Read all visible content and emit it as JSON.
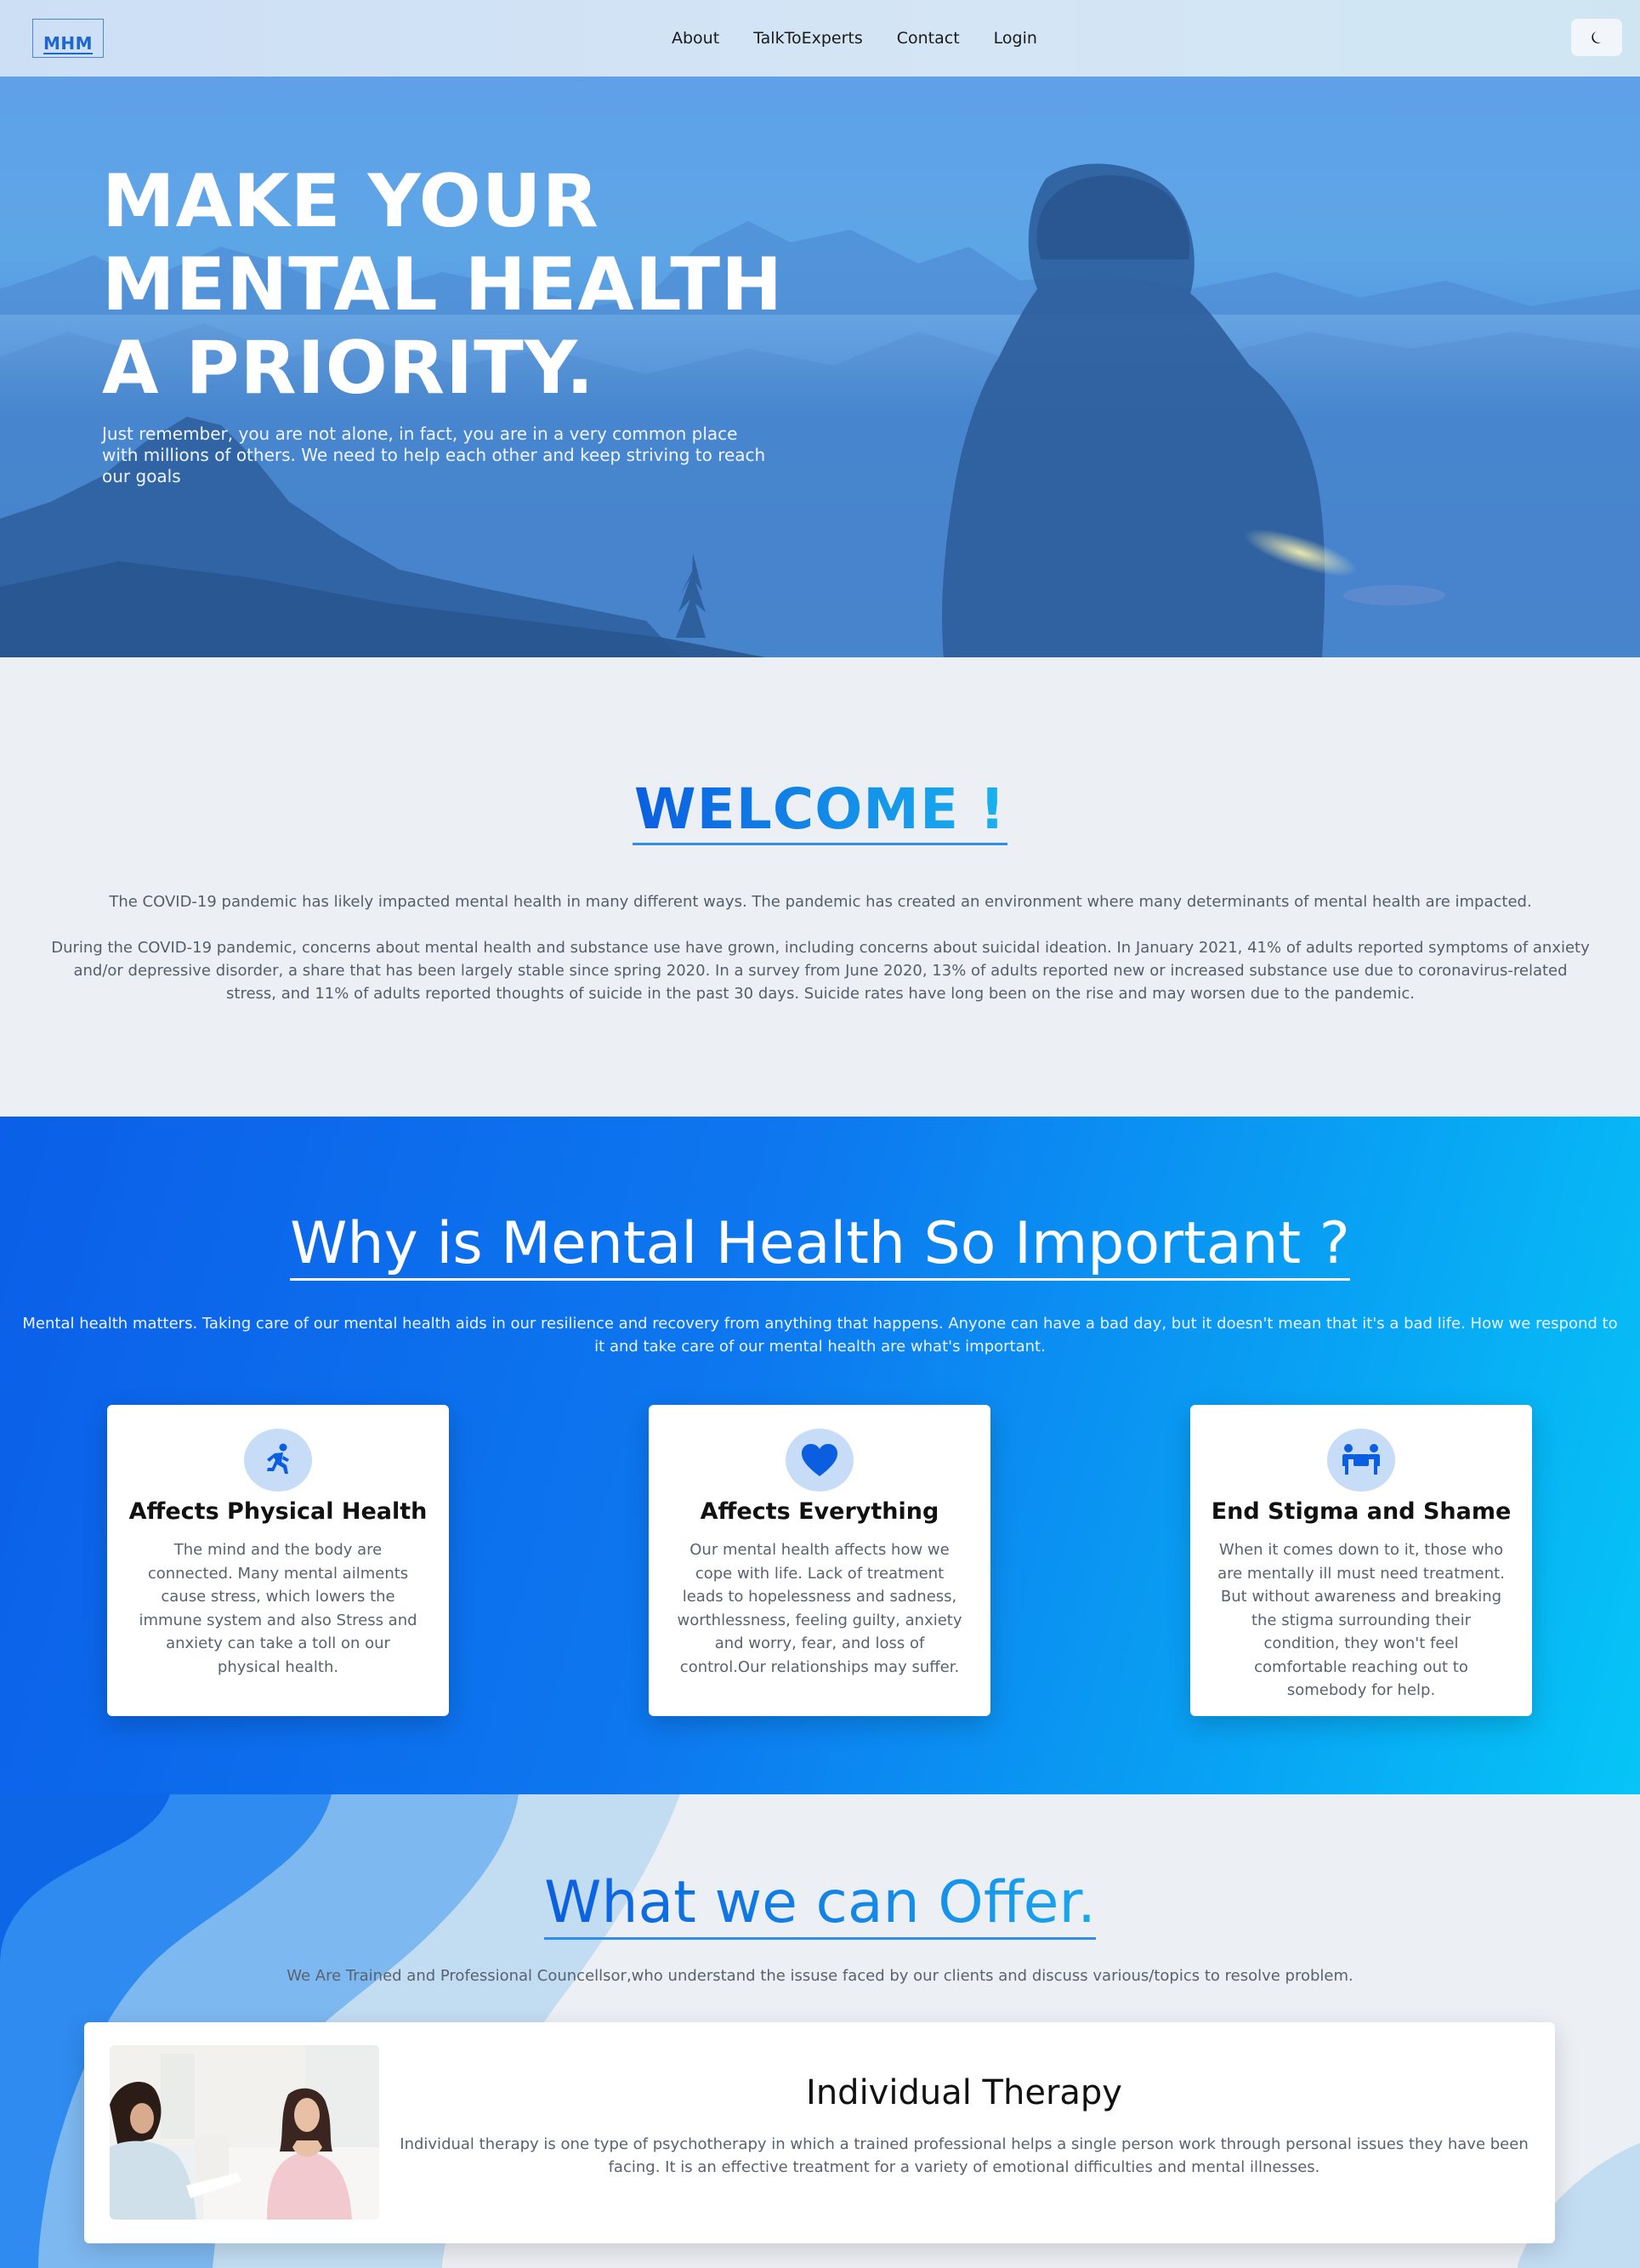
{
  "nav": {
    "logo_text": "MHM",
    "links": [
      "About",
      "TalkToExperts",
      "Contact",
      "Login"
    ],
    "theme_icon": "moon-icon"
  },
  "hero": {
    "title_lines": [
      "MAKE YOUR",
      "MENTAL HEALTH",
      "A PRIORITY."
    ],
    "subtitle": "Just remember, you are not alone, in fact, you are in a very common place with millions of others. We need to help each other and keep striving to reach our goals"
  },
  "welcome": {
    "heading": "WELCOME !",
    "paragraph1": "The COVID-19 pandemic has likely impacted mental health in many different ways. The pandemic has created an environment where many determinants of mental health are impacted.",
    "paragraph2": "During the COVID-19 pandemic, concerns about mental health and substance use have grown, including concerns about suicidal ideation. In January 2021, 41% of adults reported symptoms of anxiety and/or depressive disorder, a share that has been largely stable since spring 2020. In a survey from June 2020, 13% of adults reported new or increased substance use due to coronavirus-related stress, and 11% of adults reported thoughts of suicide in the past 30 days. Suicide rates have long been on the rise and may worsen due to the pandemic."
  },
  "why": {
    "heading": "Why is Mental Health So Important ?",
    "lead": "Mental health matters. Taking care of our mental health aids in our resilience and recovery from anything that happens. Anyone can have a bad day, but it doesn't mean that it's a bad life. How we respond to it and take care of our mental health are what's important.",
    "cards": [
      {
        "icon": "running-person-icon",
        "title": "Affects Physical Health",
        "text": "The mind and the body are connected. Many mental ailments cause stress, which lowers the immune system and also Stress and anxiety can take a toll on our physical health."
      },
      {
        "icon": "heart-icon",
        "title": "Affects Everything",
        "text": "Our mental health affects how we cope with life. Lack of treatment leads to hopelessness and sadness, worthlessness, feeling guilty, anxiety and worry, fear, and loss of control.Our relationships may suffer."
      },
      {
        "icon": "people-holding-box-icon",
        "title": "End Stigma and Shame",
        "text": "When it comes down to it, those who are mentally ill must need treatment. But without awareness and breaking the stigma surrounding their condition, they won't feel comfortable reaching out to somebody for help."
      }
    ]
  },
  "offer": {
    "heading": "What we can Offer.",
    "lead": "We Are Trained and Professional Councellsor,who understand the issuse faced by our clients and discuss various/topics to resolve problem.",
    "service": {
      "title": "Individual Therapy",
      "text": "Individual therapy is one type of psychotherapy in which a trained professional helps a single person work through personal issues they have been facing. It is an effective treatment for a variety of emotional difficulties and mental illnesses."
    }
  },
  "colors": {
    "accent_blue": "#0b5ee0",
    "accent_cyan": "#1ab2ef",
    "why_gradient_start": "#0b5fe8",
    "why_gradient_end": "#06c5f6"
  }
}
